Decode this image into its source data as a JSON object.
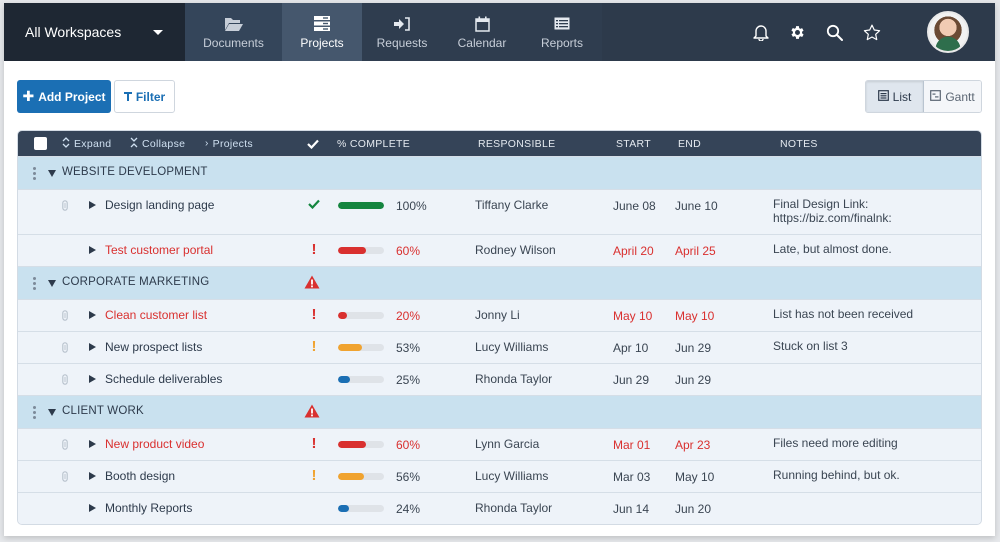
{
  "nav": {
    "workspace": "All Workspaces",
    "tabs": [
      {
        "label": "Documents",
        "icon": "folder-open-icon"
      },
      {
        "label": "Projects",
        "icon": "projects-icon",
        "active": true
      },
      {
        "label": "Requests",
        "icon": "sign-in-icon"
      },
      {
        "label": "Calendar",
        "icon": "calendar-icon"
      },
      {
        "label": "Reports",
        "icon": "report-icon"
      }
    ],
    "icons": [
      "bell-icon",
      "gear-icon",
      "search-icon",
      "star-icon"
    ]
  },
  "toolbar": {
    "add_label": "Add Project",
    "filter_label": "Filter",
    "views": [
      {
        "label": "List",
        "active": true
      },
      {
        "label": "Gantt",
        "active": false
      }
    ]
  },
  "table": {
    "header": {
      "expand": "Expand",
      "collapse": "Collapse",
      "projects": "Projects",
      "complete": "% COMPLETE",
      "responsible": "RESPONSIBLE",
      "start": "START",
      "end": "END",
      "notes": "NOTES"
    },
    "groups": [
      {
        "name": "WEBSITE DEVELOPMENT",
        "warning": false,
        "tasks": [
          {
            "name": "Design landing page",
            "attachment": true,
            "status": "done",
            "percent": 100,
            "pct_label": "100%",
            "responsible": "Tiffany Clarke",
            "start": "June 08",
            "end": "June 10",
            "late": false,
            "notes": "Final Design Link:\nhttps://biz.com/finalnk:"
          },
          {
            "name": "Test customer portal",
            "attachment": false,
            "status": "late",
            "percent": 60,
            "pct_label": "60%",
            "responsible": "Rodney Wilson",
            "start": "April 20",
            "end": "April 25",
            "late": true,
            "notes": "Late, but almost done."
          }
        ]
      },
      {
        "name": "CORPORATE MARKETING",
        "warning": true,
        "tasks": [
          {
            "name": "Clean customer list",
            "attachment": true,
            "status": "late",
            "percent": 20,
            "pct_label": "20%",
            "responsible": "Jonny Li",
            "start": "May 10",
            "end": "May 10",
            "late": true,
            "notes": "List has not been received"
          },
          {
            "name": "New prospect lists",
            "attachment": true,
            "status": "warning",
            "percent": 53,
            "pct_label": "53%",
            "responsible": "Lucy Williams",
            "start": "Apr 10",
            "end": "Jun 29",
            "late": false,
            "notes": "Stuck on list 3"
          },
          {
            "name": "Schedule deliverables",
            "attachment": true,
            "status": "normal",
            "percent": 25,
            "pct_label": "25%",
            "responsible": "Rhonda Taylor",
            "start": "Jun 29",
            "end": "Jun 29",
            "late": false,
            "notes": ""
          }
        ]
      },
      {
        "name": "CLIENT WORK",
        "warning": true,
        "tasks": [
          {
            "name": "New product video",
            "attachment": true,
            "status": "late",
            "percent": 60,
            "pct_label": "60%",
            "responsible": "Lynn Garcia",
            "start": "Mar 01",
            "end": "Apr 23",
            "late": true,
            "notes": "Files need more editing"
          },
          {
            "name": "Booth design",
            "attachment": true,
            "status": "warning",
            "percent": 56,
            "pct_label": "56%",
            "responsible": "Lucy Williams",
            "start": "Mar 03",
            "end": "May 10",
            "late": false,
            "notes": "Running behind, but ok."
          },
          {
            "name": "Monthly Reports",
            "attachment": false,
            "status": "normal",
            "percent": 24,
            "pct_label": "24%",
            "responsible": "Rhonda Taylor",
            "start": "Jun 14",
            "end": "Jun 20",
            "late": false,
            "notes": ""
          }
        ]
      }
    ]
  },
  "colors": {
    "done": "#14853f",
    "late": "#d9302f",
    "warning": "#f0a330",
    "normal": "#1b6fb4",
    "accent": "#1b6fb4"
  }
}
